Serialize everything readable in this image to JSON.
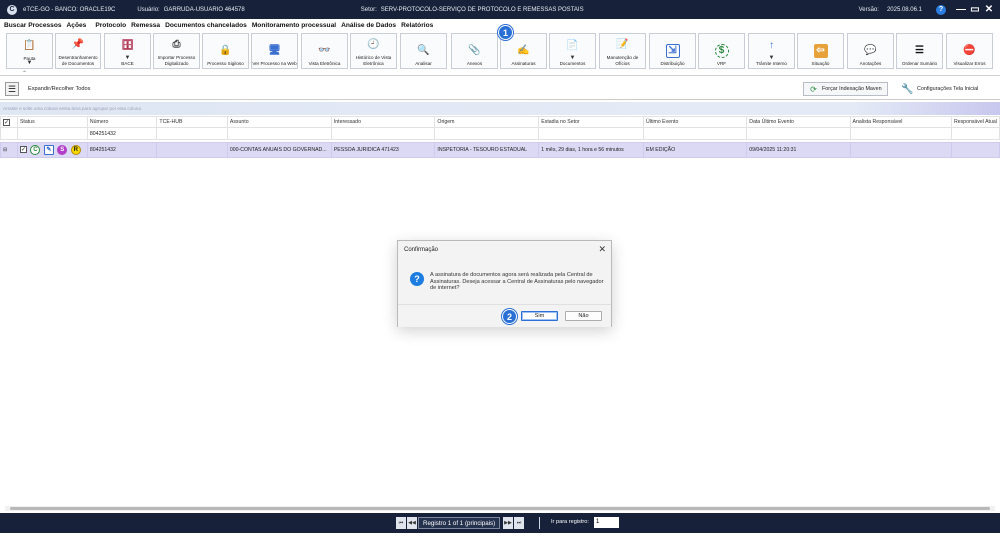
{
  "titlebar": {
    "app": "eTCE-GO - BANCO: ORACLE19C",
    "user_label": "Usuário:",
    "user": "GARRUDA-USUARIO 464578",
    "sector_label": "Setor:",
    "sector": "SERV-PROTOCOLO-SERVIÇO DE PROTOCOLO E REMESSAS POSTAIS",
    "version_label": "Versão:",
    "version": "2025.08.06.1",
    "help_glyph": "?",
    "minimize_glyph": "—",
    "restore_glyph": "▭",
    "close_glyph": "✕"
  },
  "menu": [
    "Buscar Processos",
    "Ações",
    "Protocolo",
    "Remessa",
    "Documentos chancelados",
    "Monitoramento processual",
    "Análise de Dados",
    "Relatórios"
  ],
  "ribbon": {
    "buttons": [
      {
        "label": "Pauta",
        "dropdown": "▼",
        "icon": "agenda-icon",
        "glyph": "📋"
      },
      {
        "label": "Desentranhamento de Documentos",
        "icon": "unpin-icon",
        "glyph": "📌"
      },
      {
        "label": "BACE",
        "dropdown": "▼",
        "icon": "archive-icon",
        "glyph": "🗄"
      },
      {
        "label": "Importar Processo Digitalizado",
        "icon": "scanner-icon",
        "glyph": "⎙"
      },
      {
        "label": "Processo Sigiloso",
        "icon": "lock-icon",
        "glyph": "🔒"
      },
      {
        "label": "Ver Processo na Web",
        "icon": "web-icon",
        "glyph": "🖥"
      },
      {
        "label": "Vista Eletrônica",
        "icon": "binoculars-icon",
        "glyph": "👓"
      },
      {
        "label": "Histórico de Vista Eletrônica",
        "icon": "history-icon",
        "glyph": "🕘"
      },
      {
        "label": "Analisar",
        "icon": "document-search-icon",
        "glyph": "🔍"
      },
      {
        "label": "Anexos",
        "icon": "paperclip-icon",
        "glyph": "📎"
      },
      {
        "label": "Assinaturas",
        "icon": "signature-icon",
        "glyph": "✍"
      },
      {
        "label": "Documentos",
        "dropdown": "▼",
        "icon": "documents-icon",
        "glyph": "📄"
      },
      {
        "label": "Manutenção de Ofícios",
        "icon": "clipboard-icon",
        "glyph": "📝"
      },
      {
        "label": "Distribuição",
        "icon": "distribution-icon",
        "glyph": "⇲"
      },
      {
        "label": "VRF",
        "icon": "money-refresh-icon",
        "glyph": "$"
      },
      {
        "label": "Trâmite Interno",
        "dropdown": "▼",
        "icon": "arrow-up-icon",
        "glyph": "↑"
      },
      {
        "label": "Situação",
        "icon": "status-arrow-icon",
        "glyph": "⇦"
      },
      {
        "label": "Anotações",
        "icon": "speech-bubble-icon",
        "glyph": "💬"
      },
      {
        "label": "Ordenar Sumário",
        "icon": "numbered-list-icon",
        "glyph": "☰"
      },
      {
        "label": "Visualizar Erros",
        "icon": "error-doc-icon",
        "glyph": "⛔"
      }
    ]
  },
  "markers": {
    "one": "1",
    "two": "2"
  },
  "toolbar": {
    "expand_label": "Expandir/Recolher Todos",
    "force_label": "Forçar Indexação Maven",
    "config_label": "Configurações Tela Inicial"
  },
  "group_hint": "Arraste e solte uma coluna nesta área para agrupar por esta coluna",
  "grid": {
    "columns": [
      "Status",
      "Número",
      "TCE-HUB",
      "Assunto",
      "Interessado",
      "Origem",
      "Estadia no Setor",
      "Último Evento",
      "Data Último Evento",
      "Analista Responsável",
      "Responsável Atual"
    ],
    "filter_numero": "804251432",
    "row": {
      "status_icons": [
        {
          "name": "status-c-icon",
          "glyph": "C",
          "color": "#2b8a3e"
        },
        {
          "name": "status-edit-icon",
          "glyph": "✎",
          "color": "#3a6fd0"
        },
        {
          "name": "status-s-icon",
          "glyph": "S",
          "color": "#b23fc8"
        },
        {
          "name": "status-r-icon",
          "glyph": "R",
          "color": "#e6b400"
        }
      ],
      "numero": "804251432",
      "tce_hub": "",
      "assunto": "000-CONTAS ANUAIS DO GOVERNAD...",
      "interessado": "PESSOA JURIDICA 471423",
      "origem": "INSPETORIA - TESOURO ESTADUAL",
      "estadia": "1 mês, 29 dias, 1 hora e 56 minutos",
      "ultimo_evento": "EM EDIÇÃO",
      "data_ultimo_evento": "09/04/2025 11:20:31",
      "analista": "",
      "responsavel": ""
    }
  },
  "footer": {
    "first": "⏮",
    "prev": "◀◀",
    "next": "▶▶",
    "last": "⏭",
    "records": "Registro 1 of 1 (principais)",
    "goto_label": "Ir para registro:",
    "goto_value": "1"
  },
  "dialog": {
    "title": "Confirmação",
    "close_glyph": "✕",
    "icon_glyph": "?",
    "message": "A assinatura de documentos agora será realizada pela Central de Assinaturas. Deseja acessar a Central de Assinaturas pelo navegador de internet?",
    "yes_label": "Sim",
    "no_label": "Não"
  }
}
